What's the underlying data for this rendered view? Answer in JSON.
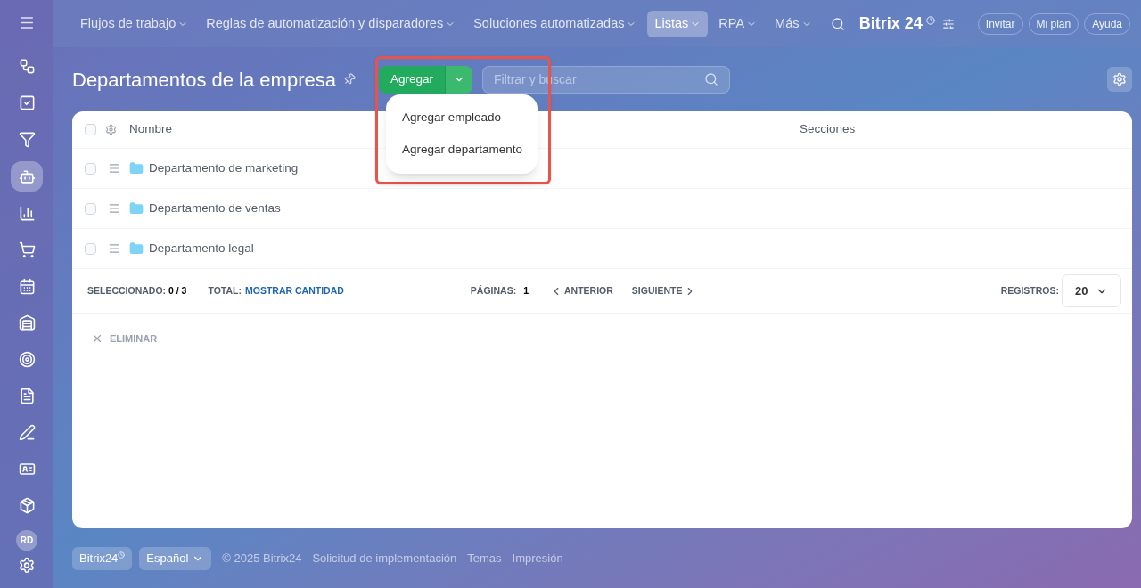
{
  "top_nav": {
    "items": [
      {
        "label": "Flujos de trabajo",
        "selected": false
      },
      {
        "label": "Reglas de automatización y disparadores",
        "selected": false
      },
      {
        "label": "Soluciones automatizadas",
        "selected": false
      },
      {
        "label": "Listas",
        "selected": true
      },
      {
        "label": "RPA",
        "selected": false
      },
      {
        "label": "Más",
        "selected": false
      }
    ],
    "logo": "Bitrix 24",
    "buttons": [
      "Invitar",
      "Mi plan",
      "Ayuda"
    ]
  },
  "sidebar": {
    "items": [
      {
        "kind": "flows",
        "selected": false
      },
      {
        "kind": "tasks",
        "selected": false
      },
      {
        "kind": "funnel",
        "selected": false
      },
      {
        "kind": "robot",
        "selected": true
      },
      {
        "kind": "chart",
        "selected": false
      },
      {
        "kind": "cart",
        "selected": false
      },
      {
        "kind": "calendar",
        "selected": false
      },
      {
        "kind": "warehouse",
        "selected": false
      },
      {
        "kind": "target",
        "selected": false
      },
      {
        "kind": "document",
        "selected": false
      },
      {
        "kind": "sign",
        "selected": false
      },
      {
        "kind": "card",
        "selected": false
      },
      {
        "kind": "box",
        "selected": false
      }
    ],
    "avatar": "RD"
  },
  "page": {
    "title": "Departamentos de la empresa",
    "add_button": "Agregar",
    "search": {
      "placeholder": "Filtrar y buscar"
    },
    "add_menu": [
      "Agregar empleado",
      "Agregar departamento"
    ]
  },
  "table": {
    "select_all_checked": false,
    "columns": [
      "Nombre",
      "Secciones"
    ],
    "rows": [
      {
        "name": "Departamento de marketing",
        "checked": false
      },
      {
        "name": "Departamento de ventas",
        "checked": false
      },
      {
        "name": "Departamento legal",
        "checked": false
      }
    ],
    "footer": {
      "selected_label": "SELECCIONADO:",
      "selected_value": "0 / 3",
      "total_label": "TOTAL:",
      "total_link": "MOSTRAR CANTIDAD",
      "pages_label": "PÁGINAS:",
      "pages_value": "1",
      "prev": "ANTERIOR",
      "next": "SIGUIENTE",
      "records_label": "REGISTROS:",
      "records_value": "20"
    },
    "delete_action": "ELIMINAR"
  },
  "footer": {
    "brand": "Bitrix24",
    "language": "Español",
    "links": [
      "© 2025 Bitrix24",
      "Solicitud de implementación",
      "Temas",
      "Impresión"
    ]
  }
}
